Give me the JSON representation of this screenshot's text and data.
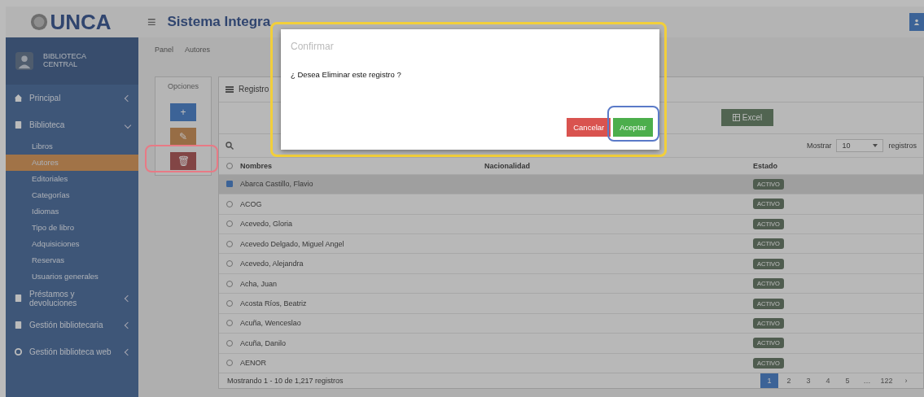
{
  "header": {
    "logo": "UNCA",
    "menu_glyph": "≡",
    "title": "Sistema Integra"
  },
  "sidebar": {
    "user": "BIBLIOTECA CENTRAL",
    "items": [
      {
        "label": "Principal",
        "expanded": false
      },
      {
        "label": "Biblioteca",
        "expanded": true,
        "children": [
          {
            "label": "Libros",
            "selected": false
          },
          {
            "label": "Autores",
            "selected": true
          },
          {
            "label": "Editoriales",
            "selected": false
          },
          {
            "label": "Categorías",
            "selected": false
          },
          {
            "label": "Idiomas",
            "selected": false
          },
          {
            "label": "Tipo de libro",
            "selected": false
          },
          {
            "label": "Adquisiciones",
            "selected": false
          },
          {
            "label": "Reservas",
            "selected": false
          },
          {
            "label": "Usuarios generales",
            "selected": false
          }
        ]
      },
      {
        "label": "Préstamos y devoluciones",
        "expanded": false
      },
      {
        "label": "Gestión bibliotecaria",
        "expanded": false
      },
      {
        "label": "Gestión biblioteca web",
        "expanded": false
      }
    ]
  },
  "breadcrumb": [
    "Panel",
    "Autores"
  ],
  "options": {
    "title": "Opciones",
    "buttons": [
      {
        "kind": "add",
        "glyph": "+"
      },
      {
        "kind": "edit",
        "glyph": "✎"
      },
      {
        "kind": "delete",
        "glyph": "🗑"
      }
    ]
  },
  "table_panel": {
    "title": "Registro",
    "export_button": "Excel",
    "show_label": "Mostrar",
    "page_size": "10",
    "records_label": "registros",
    "columns": [
      "Nombres",
      "Nacionalidad",
      "Estado"
    ],
    "rows": [
      {
        "name": "Abarca Castillo, Flavio",
        "status": "ACTIVO",
        "selected": true
      },
      {
        "name": "ACOG",
        "status": "ACTIVO",
        "selected": false
      },
      {
        "name": "Acevedo, Gloria",
        "status": "ACTIVO",
        "selected": false
      },
      {
        "name": "Acevedo Delgado, Miguel Angel",
        "status": "ACTIVO",
        "selected": false
      },
      {
        "name": "Acevedo, Alejandra",
        "status": "ACTIVO",
        "selected": false
      },
      {
        "name": "Acha, Juan",
        "status": "ACTIVO",
        "selected": false
      },
      {
        "name": "Acosta Ríos, Beatriz",
        "status": "ACTIVO",
        "selected": false
      },
      {
        "name": "Acuña, Wenceslao",
        "status": "ACTIVO",
        "selected": false
      },
      {
        "name": "Acuña, Danilo",
        "status": "ACTIVO",
        "selected": false
      },
      {
        "name": "AENOR",
        "status": "ACTIVO",
        "selected": false
      }
    ],
    "footer": "Mostrando 1 - 10 de 1,217 registros",
    "pages": [
      {
        "label": "1",
        "selected": true
      },
      {
        "label": "2",
        "selected": false
      },
      {
        "label": "3",
        "selected": false
      },
      {
        "label": "4",
        "selected": false
      },
      {
        "label": "5",
        "selected": false
      },
      {
        "label": "…",
        "selected": false
      },
      {
        "label": "122",
        "selected": false
      },
      {
        "label": "›",
        "selected": false
      }
    ]
  },
  "modal": {
    "title": "Confirmar",
    "message": "¿ Desea Eliminar este registro ?",
    "buttons": [
      {
        "kind": "cancel",
        "label": "Cancelar"
      },
      {
        "kind": "accept",
        "label": "Aceptar"
      }
    ]
  }
}
